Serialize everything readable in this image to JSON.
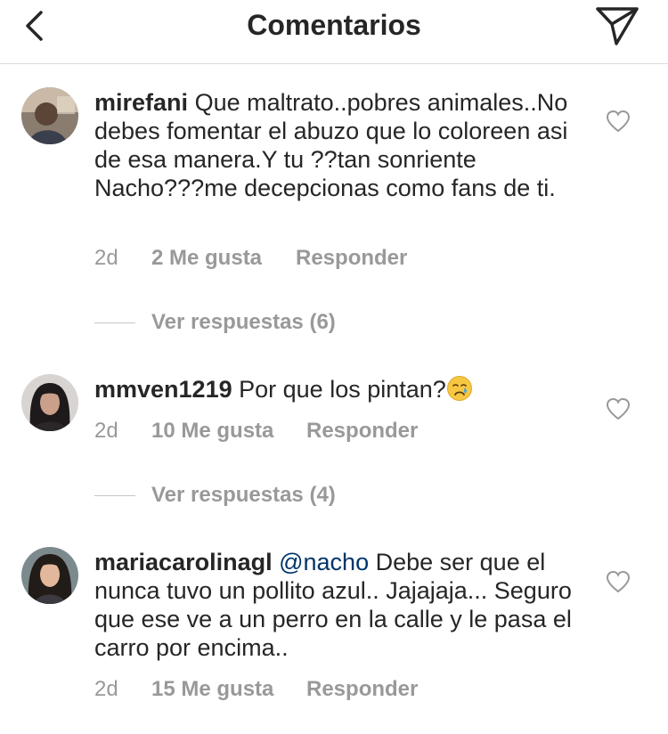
{
  "header": {
    "title": "Comentarios",
    "back_icon": "chevron-left-icon",
    "send_icon": "paper-plane-icon"
  },
  "comments": [
    {
      "username": "mirefani",
      "text": "Que maltrato..pobres animales..No debes fomentar el abuzo que lo coloreen asi de esa manera.Y tu ??tan sonriente Nacho???me decepcionas como fans de ti.",
      "time": "2d",
      "likes": "2 Me gusta",
      "reply_label": "Responder",
      "view_replies": "Ver respuestas (6)"
    },
    {
      "username": "mmven1219",
      "text": "Por que los pintan?",
      "emoji": "crying-face-icon",
      "time": "2d",
      "likes": "10 Me gusta",
      "reply_label": "Responder",
      "view_replies": "Ver respuestas (4)"
    },
    {
      "username": "mariacarolinagl",
      "mention": "@nacho",
      "text": "Debe ser que el nunca tuvo un pollito azul.. Jajajaja... Seguro que ese ve a un perro en la calle y le pasa el carro por encima..",
      "time": "2d",
      "likes": "15 Me gusta",
      "reply_label": "Responder"
    }
  ],
  "colors": {
    "text": "#262626",
    "secondary": "#999999",
    "mention": "#003569",
    "divider": "#dbdbdb"
  }
}
